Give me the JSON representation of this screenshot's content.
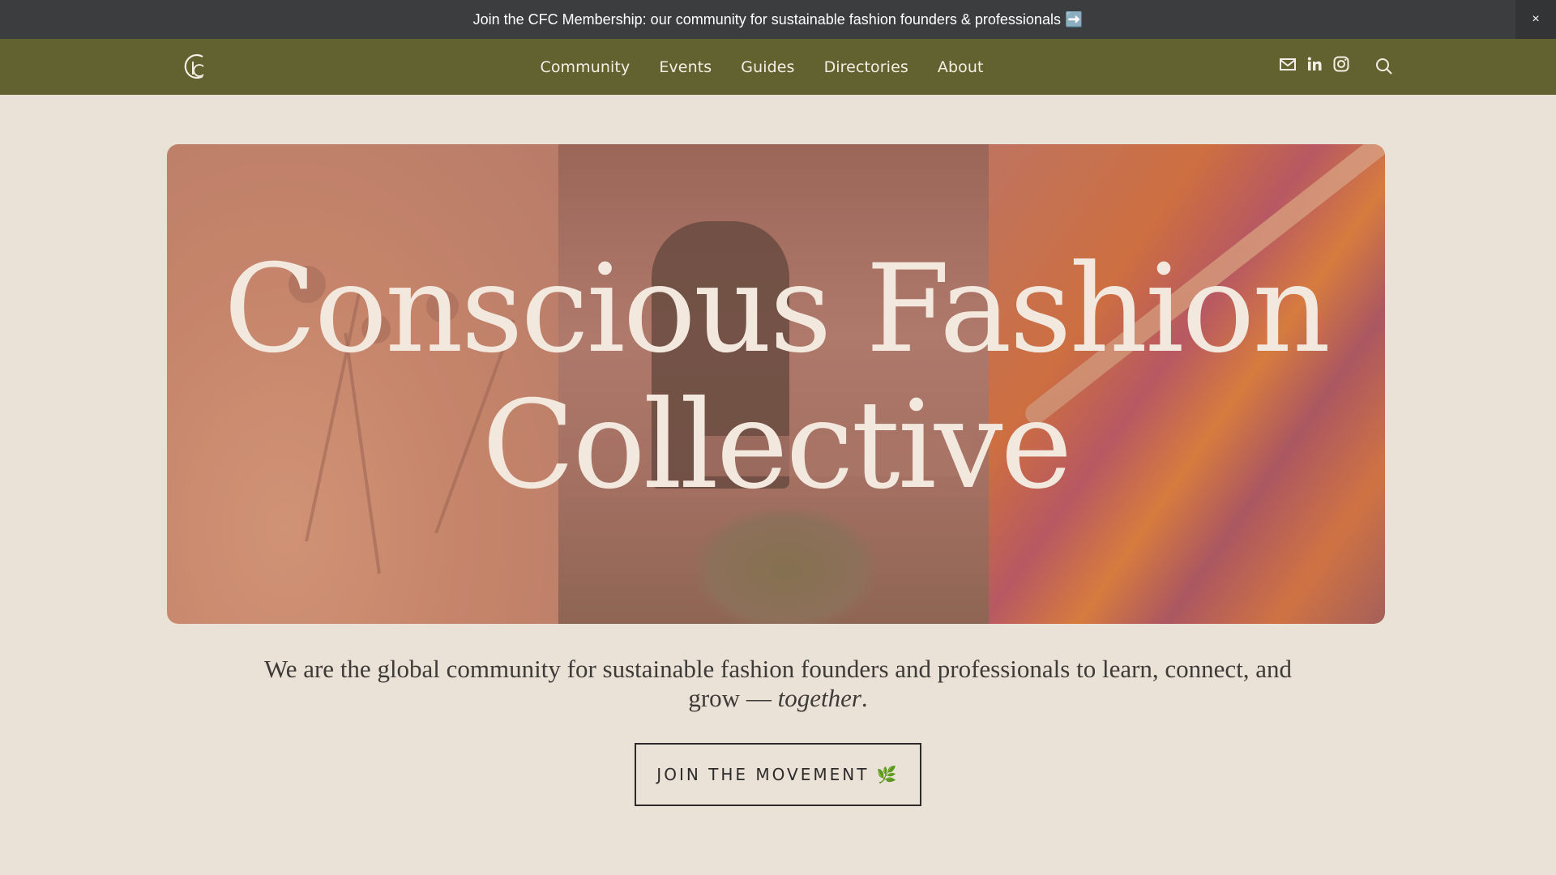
{
  "announcement": {
    "text": "Join the CFC Membership: our community for sustainable fashion founders & professionals ➡️",
    "close_label": "×"
  },
  "header": {
    "logo_alt": "CFC",
    "nav": [
      "Community",
      "Events",
      "Guides",
      "Directories",
      "About"
    ],
    "social_icons": [
      "mail-icon",
      "linkedin-icon",
      "instagram-icon"
    ],
    "search_icon": "search-icon"
  },
  "hero": {
    "title_line1": "Conscious Fashion",
    "title_line2": "Collective"
  },
  "tagline": {
    "text": "We are the global community for sustainable fashion founders and professionals to learn, connect, and grow — ",
    "emphasis": "together",
    "end": "."
  },
  "cta": {
    "label": "JOIN THE MOVEMENT 🌿"
  },
  "colors": {
    "announcement_bg": "#3c3d3f",
    "header_bg": "#61622f",
    "page_bg": "#ebe2d7",
    "hero_text": "#f3e8de"
  }
}
